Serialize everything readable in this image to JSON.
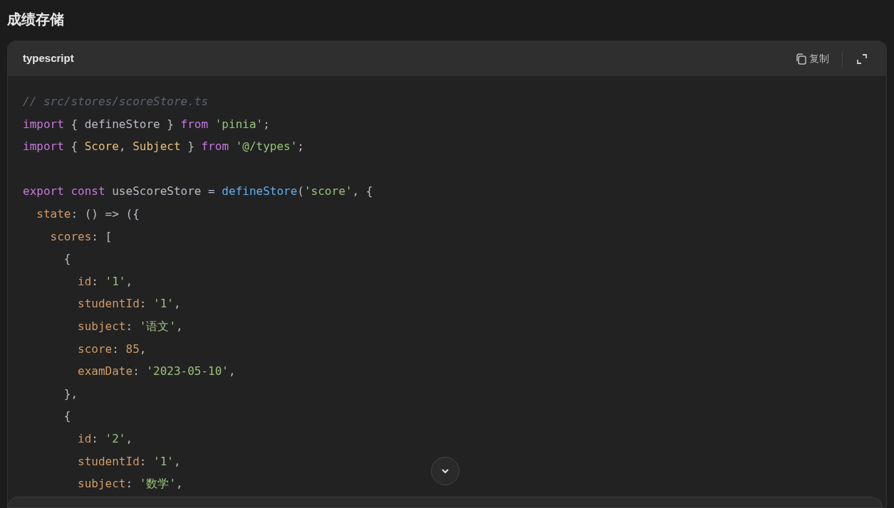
{
  "heading": "成绩存储",
  "code_block": {
    "language": "typescript",
    "copy_label": "复制",
    "lines": [
      {
        "kind": "code",
        "tokens": [
          {
            "kind": "comment",
            "text": "// src/stores/scoreStore.ts"
          }
        ]
      },
      {
        "kind": "code",
        "tokens": [
          {
            "kind": "kw",
            "text": "import"
          },
          {
            "kind": "plain",
            "text": " { defineStore } "
          },
          {
            "kind": "kw",
            "text": "from"
          },
          {
            "kind": "str",
            "text": " 'pinia'"
          },
          {
            "kind": "plain",
            "text": ";"
          }
        ]
      },
      {
        "kind": "code",
        "tokens": [
          {
            "kind": "kw",
            "text": "import"
          },
          {
            "kind": "plain",
            "text": " { "
          },
          {
            "kind": "type",
            "text": "Score"
          },
          {
            "kind": "plain",
            "text": ", "
          },
          {
            "kind": "type",
            "text": "Subject"
          },
          {
            "kind": "plain",
            "text": " } "
          },
          {
            "kind": "kw",
            "text": "from"
          },
          {
            "kind": "str",
            "text": " '@/types'"
          },
          {
            "kind": "plain",
            "text": ";"
          }
        ]
      },
      {
        "kind": "blank"
      },
      {
        "kind": "code",
        "tokens": [
          {
            "kind": "kw",
            "text": "export"
          },
          {
            "kind": "kw",
            "text": " const"
          },
          {
            "kind": "plain",
            "text": " useScoreStore = "
          },
          {
            "kind": "fn",
            "text": "defineStore"
          },
          {
            "kind": "plain",
            "text": "("
          },
          {
            "kind": "str",
            "text": "'score'"
          },
          {
            "kind": "plain",
            "text": ", {"
          }
        ]
      },
      {
        "kind": "code",
        "tokens": [
          {
            "kind": "prop",
            "text": "  state"
          },
          {
            "kind": "plain",
            "text": ": () => ({"
          }
        ]
      },
      {
        "kind": "code",
        "tokens": [
          {
            "kind": "prop",
            "text": "    scores"
          },
          {
            "kind": "plain",
            "text": ": ["
          }
        ]
      },
      {
        "kind": "code",
        "tokens": [
          {
            "kind": "plain",
            "text": "      {"
          }
        ]
      },
      {
        "kind": "code",
        "tokens": [
          {
            "kind": "prop",
            "text": "        id"
          },
          {
            "kind": "plain",
            "text": ": "
          },
          {
            "kind": "str",
            "text": "'1'"
          },
          {
            "kind": "plain",
            "text": ","
          }
        ]
      },
      {
        "kind": "code",
        "tokens": [
          {
            "kind": "prop",
            "text": "        studentId"
          },
          {
            "kind": "plain",
            "text": ": "
          },
          {
            "kind": "str",
            "text": "'1'"
          },
          {
            "kind": "plain",
            "text": ","
          }
        ]
      },
      {
        "kind": "code",
        "tokens": [
          {
            "kind": "prop",
            "text": "        subject"
          },
          {
            "kind": "plain",
            "text": ": "
          },
          {
            "kind": "str",
            "text": "'语文'"
          },
          {
            "kind": "plain",
            "text": ","
          }
        ]
      },
      {
        "kind": "code",
        "tokens": [
          {
            "kind": "prop",
            "text": "        score"
          },
          {
            "kind": "plain",
            "text": ": "
          },
          {
            "kind": "num",
            "text": "85"
          },
          {
            "kind": "plain",
            "text": ","
          }
        ]
      },
      {
        "kind": "code",
        "tokens": [
          {
            "kind": "prop",
            "text": "        examDate"
          },
          {
            "kind": "plain",
            "text": ": "
          },
          {
            "kind": "str",
            "text": "'2023-05-10'"
          },
          {
            "kind": "plain",
            "text": ","
          }
        ]
      },
      {
        "kind": "code",
        "tokens": [
          {
            "kind": "plain",
            "text": "      },"
          }
        ]
      },
      {
        "kind": "code",
        "tokens": [
          {
            "kind": "plain",
            "text": "      {"
          }
        ]
      },
      {
        "kind": "code",
        "tokens": [
          {
            "kind": "prop",
            "text": "        id"
          },
          {
            "kind": "plain",
            "text": ": "
          },
          {
            "kind": "str",
            "text": "'2'"
          },
          {
            "kind": "plain",
            "text": ","
          }
        ]
      },
      {
        "kind": "code",
        "tokens": [
          {
            "kind": "prop",
            "text": "        studentId"
          },
          {
            "kind": "plain",
            "text": ": "
          },
          {
            "kind": "str",
            "text": "'1'"
          },
          {
            "kind": "plain",
            "text": ","
          }
        ]
      },
      {
        "kind": "code",
        "tokens": [
          {
            "kind": "prop",
            "text": "        subject"
          },
          {
            "kind": "plain",
            "text": ": "
          },
          {
            "kind": "str",
            "text": "'数学'"
          },
          {
            "kind": "plain",
            "text": ","
          }
        ]
      }
    ]
  }
}
